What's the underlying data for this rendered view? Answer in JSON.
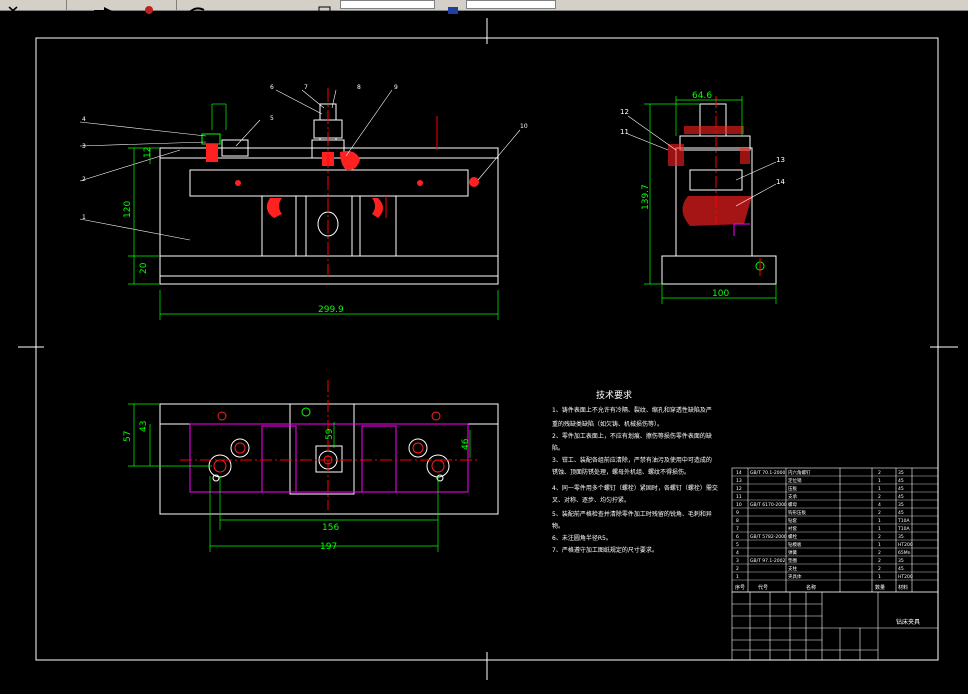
{
  "toolbar": {
    "icons": [
      "close-icon",
      "arrow-icon",
      "pan-icon",
      "undo-icon",
      "layer-icon",
      "layer-dropdown",
      "color-icon",
      "color-dropdown"
    ]
  },
  "front_view": {
    "part_numbers": [
      "4",
      "3",
      "2",
      "1",
      "6",
      "7",
      "8",
      "9",
      "5",
      "10"
    ],
    "dim_width": "299.9",
    "dim_height": "120",
    "dim_base": "20",
    "dim_small": "12"
  },
  "side_view": {
    "part_numbers": [
      "12",
      "11",
      "13",
      "14"
    ],
    "dim_top": "64.6",
    "dim_height": "139.7",
    "dim_width": "100"
  },
  "plan_view": {
    "dim_inner": "156",
    "dim_outer": "197",
    "dim_h1": "57",
    "dim_h2": "43",
    "dim_mid": "59",
    "dim_right": "46"
  },
  "tech_req": {
    "title": "技术要求",
    "lines": [
      "1、铸件表面上不允许有冷隔、裂纹、缩孔和穿透性缺陷及严",
      "重的残缺类缺陷（如欠铸、机械损伤等）。",
      "2、零件加工表面上，不应有划痕、擦伤等损伤零件表面的缺",
      "陷。",
      "3、钳工、装配各组前应清除，严禁有油污及使用中可造成的",
      "锈蚀、顶面防锈处理，螺母外机组、螺纹不得损伤。",
      "4、同一零件用多个螺钉（螺栓）紧固时，各螺钉（螺栓）需交",
      "叉、对称、逐步、均匀拧紧。",
      "5、装配前严格检查并清除零件加工时残留的锐角、毛刺和异",
      "物。",
      "6、未注圆角半径R5。",
      "7、严格遵守加工图纸规定的尺寸要求。"
    ]
  },
  "title_block": {
    "drawing_name": "钻床夹具",
    "bom_rows": [
      {
        "no": "14",
        "code": "GB/T 70.1-2000",
        "name": "内六角螺钉",
        "qty": "2",
        "mat": "35"
      },
      {
        "no": "13",
        "code": "",
        "name": "定位销",
        "qty": "1",
        "mat": "45"
      },
      {
        "no": "12",
        "code": "",
        "name": "压板",
        "qty": "1",
        "mat": "45"
      },
      {
        "no": "11",
        "code": "",
        "name": "支承",
        "qty": "2",
        "mat": "45"
      },
      {
        "no": "10",
        "code": "GB/T 6170-2000",
        "name": "螺母",
        "qty": "4",
        "mat": "35"
      },
      {
        "no": "9",
        "code": "",
        "name": "钩形压板",
        "qty": "2",
        "mat": "45"
      },
      {
        "no": "8",
        "code": "",
        "name": "钻套",
        "qty": "1",
        "mat": "T10A"
      },
      {
        "no": "7",
        "code": "",
        "name": "衬套",
        "qty": "1",
        "mat": "T10A"
      },
      {
        "no": "6",
        "code": "GB/T 5782-2000",
        "name": "螺栓",
        "qty": "2",
        "mat": "35"
      },
      {
        "no": "5",
        "code": "",
        "name": "钻模板",
        "qty": "1",
        "mat": "HT200"
      },
      {
        "no": "4",
        "code": "",
        "name": "弹簧",
        "qty": "2",
        "mat": "65Mn"
      },
      {
        "no": "3",
        "code": "GB/T 97.1-2002",
        "name": "垫圈",
        "qty": "2",
        "mat": "35"
      },
      {
        "no": "2",
        "code": "",
        "name": "支柱",
        "qty": "2",
        "mat": "45"
      },
      {
        "no": "1",
        "code": "",
        "name": "夹具体",
        "qty": "1",
        "mat": "HT200"
      }
    ],
    "header": {
      "no": "序号",
      "code": "代号",
      "name": "名称",
      "qty": "数量",
      "mat": "材料"
    }
  },
  "colors": {
    "background": "#000000",
    "lines": "#ffffff",
    "dimension": "#00ff00",
    "centerline": "#ff0000",
    "hidden": "#ff00ff",
    "hatch": "#ff2020",
    "toolbar": "#d4d0c8"
  }
}
